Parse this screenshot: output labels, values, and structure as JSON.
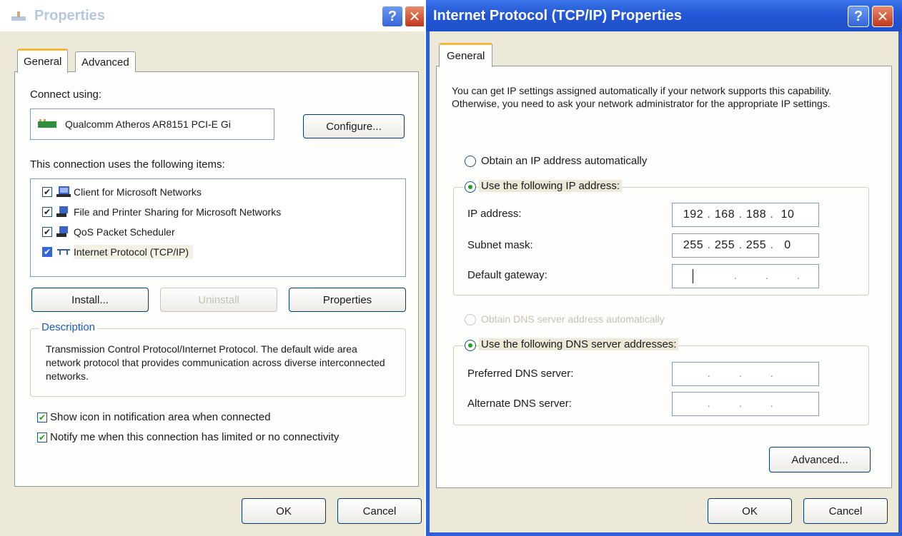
{
  "left": {
    "title": "Properties",
    "tabs": [
      "General",
      "Advanced"
    ],
    "connect_using_label": "Connect using:",
    "adapter_name": "Qualcomm Atheros AR8151 PCI-E Gi",
    "configure_label": "Configure...",
    "items_label": "This connection uses the following items:",
    "items": [
      {
        "label": "Client for Microsoft Networks",
        "checked": true
      },
      {
        "label": "File and Printer Sharing for Microsoft Networks",
        "checked": true
      },
      {
        "label": "QoS Packet Scheduler",
        "checked": true
      },
      {
        "label": "Internet Protocol (TCP/IP)",
        "checked": true
      }
    ],
    "install_label": "Install...",
    "uninstall_label": "Uninstall",
    "properties_label": "Properties",
    "description_heading": "Description",
    "description_text": "Transmission Control Protocol/Internet Protocol. The default wide area network protocol that provides communication across diverse interconnected networks.",
    "show_icon_label": "Show icon in notification area when connected",
    "notify_label": "Notify me when this connection has limited or no connectivity",
    "ok_label": "OK",
    "cancel_label": "Cancel"
  },
  "right": {
    "title": "Internet Protocol (TCP/IP) Properties",
    "tab": "General",
    "intro": "You can get IP settings assigned automatically if your network supports this capability. Otherwise, you need to ask your network administrator for the appropriate IP settings.",
    "obtain_ip_auto": "Obtain an IP address automatically",
    "use_following_ip": "Use the following IP address:",
    "ip_label": "IP address:",
    "ip_value": [
      "192",
      "168",
      "188",
      "10"
    ],
    "subnet_label": "Subnet mask:",
    "subnet_value": [
      "255",
      "255",
      "255",
      "0"
    ],
    "gateway_label": "Default gateway:",
    "obtain_dns_auto": "Obtain DNS server address automatically",
    "use_following_dns": "Use the following DNS server addresses:",
    "preferred_dns_label": "Preferred DNS server:",
    "alternate_dns_label": "Alternate DNS server:",
    "advanced_label": "Advanced...",
    "ok_label": "OK",
    "cancel_label": "Cancel"
  },
  "colors": {
    "xp_blue": "#2f5fd4",
    "dialog_face": "#ece9d8",
    "check_green": "#21a121",
    "tab_highlight": "#f3b93a"
  },
  "icons": [
    "network-properties-icon",
    "help-icon",
    "close-icon",
    "network-adapter-icon",
    "network-component-icon",
    "protocol-icon"
  ]
}
